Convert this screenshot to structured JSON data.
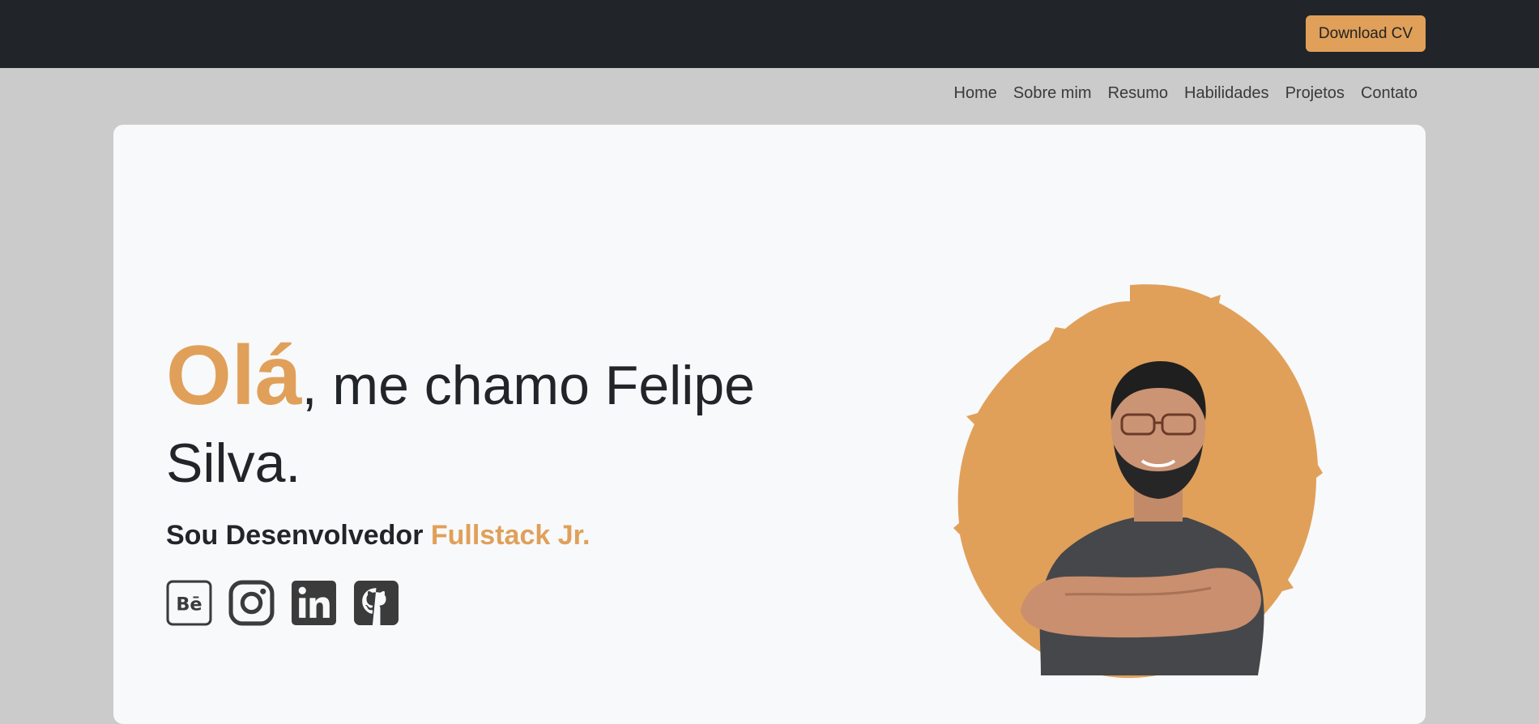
{
  "header": {
    "download_cv": "Download CV"
  },
  "nav": {
    "items": [
      "Home",
      "Sobre mim",
      "Resumo",
      "Habilidades",
      "Projetos",
      "Contato"
    ]
  },
  "hero": {
    "greeting": "Olá",
    "intro": ", me chamo ",
    "first_name": "Felipe",
    "last_name": "Silva.",
    "role_prefix": "Sou Desenvolvedor ",
    "role_highlight": "Fullstack Jr."
  },
  "socials": [
    {
      "icon": "behance-icon"
    },
    {
      "icon": "instagram-icon"
    },
    {
      "icon": "linkedin-icon"
    },
    {
      "icon": "github-icon"
    }
  ],
  "colors": {
    "accent": "#e0a05a",
    "topbar": "#212429",
    "page_bg": "#cbcbcb",
    "card_bg": "#f8f9fa",
    "text": "#212529",
    "icon": "#3b3b3b"
  }
}
